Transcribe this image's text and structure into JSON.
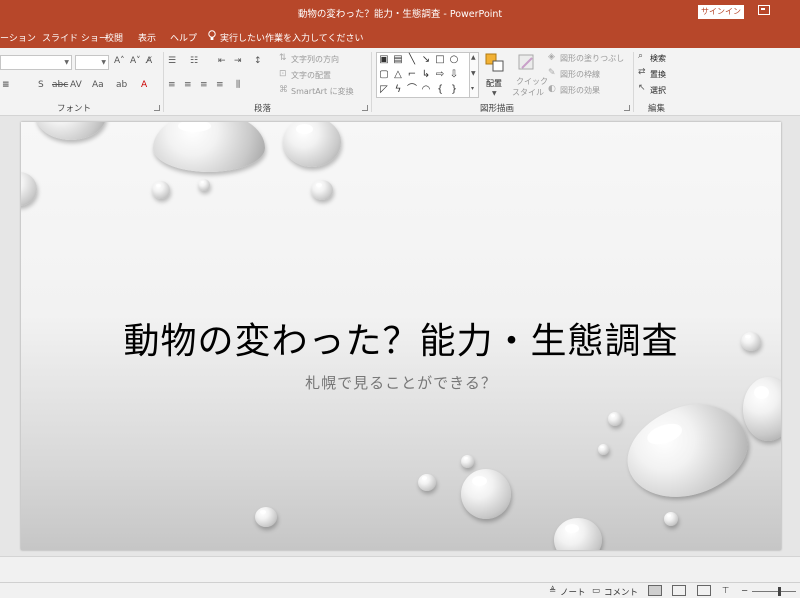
{
  "window": {
    "title": "動物の変わった？能力・生態調査  -  PowerPoint",
    "signin_label": "サインイン"
  },
  "tabs": [
    {
      "label": "ーション"
    },
    {
      "label": "スライド ショー"
    },
    {
      "label": "校閲"
    },
    {
      "label": "表示"
    },
    {
      "label": "ヘルプ"
    }
  ],
  "tell_me": {
    "label": "実行したい作業を入力してください",
    "icon": "lightbulb-icon"
  },
  "ribbon": {
    "groups": {
      "font": "フォント",
      "paragraph": "段落",
      "drawing": "図形描画",
      "editing": "編集"
    },
    "paragraph_items": {
      "text_direction": "文字列の方向",
      "align_text": "文字の配置",
      "smartart": "SmartArt に変換"
    },
    "drawing_items": {
      "arrange": "配置",
      "quick_styles_line1": "クイック",
      "quick_styles_line2": "スタイル",
      "shape_fill": "図形の塗りつぶし",
      "shape_outline": "図形の枠線",
      "shape_effects": "図形の効果"
    },
    "editing_items": {
      "find": "検索",
      "replace": "置換",
      "select": "選択"
    }
  },
  "slide": {
    "title": "動物の変わった？能力・生態調査",
    "subtitle": "札幌で見ることができる？"
  },
  "status_bar": {
    "notes_label": "ノート",
    "comments_label": "コメント"
  },
  "colors": {
    "accent": "#b7472a",
    "ribbon_bg": "#f3f3f3",
    "workspace_bg": "#e6e6e6"
  }
}
